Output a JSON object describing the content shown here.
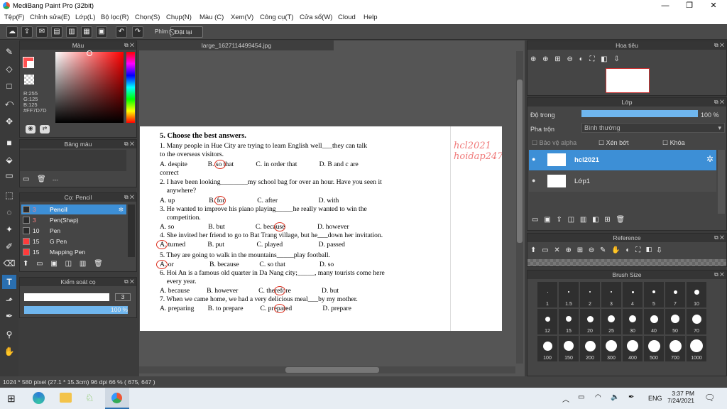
{
  "window": {
    "title": "MediBang Paint Pro (32bit)",
    "minimize": "—",
    "maximize": "❐",
    "close": "✕"
  },
  "menu": [
    "Tệp(F)",
    "Chỉnh sửa(E)",
    "Lớp(L)",
    "Bộ lọc(R)",
    "Chọn(S)",
    "Chụp(N)",
    "Màu (C)",
    "Xem(V)",
    "Công cụ(T)",
    "Cửa sổ(W)",
    "Cloud",
    "Help"
  ],
  "toolbar": {
    "phim": "Phím",
    "reset": "Đặt lại"
  },
  "color_panel": {
    "title": "Màu",
    "r": "R:255",
    "g": "G:125",
    "b": "B:125",
    "hex": "#FF7D7D",
    "primary": "#ff5050",
    "selected": "#FF7D7D"
  },
  "palette_panel": {
    "title": "Bảng màu",
    "dots": "---"
  },
  "brush_panel": {
    "title": "Cọ: Pencil",
    "items": [
      {
        "size": "3",
        "name": "Pencil",
        "color": "#2b2b2b"
      },
      {
        "size": "3",
        "name": "Pen(Shap)",
        "color": "#2b2b2b"
      },
      {
        "size": "10",
        "name": "Pen",
        "color": "#2b2b2b"
      },
      {
        "size": "15",
        "name": "G Pen",
        "color": "#ff3b3b"
      },
      {
        "size": "15",
        "name": "Mapping Pen",
        "color": "#ff3b3b"
      }
    ]
  },
  "brush_control": {
    "title": "Kiểm soát cọ",
    "size": "3",
    "opacity": "100 %"
  },
  "document": {
    "tab": "large_1627114499454.jpg",
    "watermark1": "hcl2021",
    "watermark2": "hoidap247",
    "lines": [
      {
        "t": "5. Choose the best answers.",
        "b": true
      },
      {
        "t": "1. Many people in Hue City are trying to learn English well___they can talk"
      },
      {
        "t": "to the overseas visitors."
      },
      {
        "t": "A. despite            B. so that             C. in order that             D. B and c are"
      },
      {
        "t": "correct"
      },
      {
        "t": "2. I have been looking________my school bag for over an hour. Have you seen it"
      },
      {
        "t": "    anywhere?"
      },
      {
        "t": "A. up                    B. for                   C. after                        D. with"
      },
      {
        "t": "3. He wanted to improve his piano playing_____he really wanted to win the"
      },
      {
        "t": "    competition."
      },
      {
        "t": "A. so                    B. but                  C. because                   D. however"
      },
      {
        "t": "4. She invited her friend to go to Bat Trang village, but he___down her invitation."
      },
      {
        "t": "A. turned             B. put                   C. played                     D. passed"
      },
      {
        "t": "5. They are going to walk in the mountains_____play football."
      },
      {
        "t": "A. or                     B. because            C. so that                    D. so"
      },
      {
        "t": "6. Hoi An is a famous old quarter in Da Nang city;_____, many tourists come here"
      },
      {
        "t": "    every year."
      },
      {
        "t": "A. because          B. however            C. therefore                  D. but"
      },
      {
        "t": "7. When we came home, we had a very delicious meal___by my mother."
      },
      {
        "t": "A. preparing        B. to prepare          C. prepared                  D. prepare"
      }
    ]
  },
  "navigator": {
    "title": "Hoa tiêu"
  },
  "layer_panel": {
    "title": "Lớp",
    "opacity_label": "Độ trong",
    "opacity": "100 %",
    "opacity_fraction": 1.0,
    "blend_label": "Pha trộn",
    "blend": "Bình thường",
    "protect_alpha": "Bảo vệ alpha",
    "clip": "Xén bớt",
    "lock": "Khóa",
    "layers": [
      {
        "name": "hcl2021",
        "selected": true
      },
      {
        "name": "Lớp1",
        "selected": false
      }
    ]
  },
  "reference": {
    "title": "Reference"
  },
  "brush_size": {
    "title": "Brush Size",
    "sizes": [
      "1",
      "1.5",
      "2",
      "3",
      "4",
      "5",
      "7",
      "10",
      "12",
      "15",
      "20",
      "25",
      "30",
      "40",
      "50",
      "70",
      "100",
      "150",
      "200",
      "300",
      "400",
      "500",
      "700",
      "1000"
    ]
  },
  "status": {
    "text": "1024 * 580 pixel   (27.1 * 15.3cm)   96 dpi   66 %   ( 675, 647 )"
  },
  "taskbar": {
    "time": "3:37 PM",
    "date": "7/24/2021",
    "lang": "ENG"
  }
}
